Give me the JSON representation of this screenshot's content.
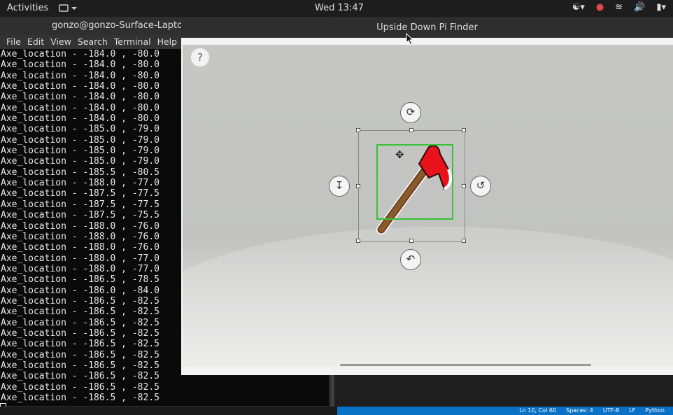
{
  "topbar": {
    "activities": "Activities",
    "clock": "Wed 13:47",
    "tray_icons": [
      "accessibility-icon",
      "record-icon",
      "wifi-icon",
      "volume-icon",
      "battery-icon",
      "power-menu-icon"
    ]
  },
  "terminal": {
    "title": "gonzo@gonzo-Surface-Laptop-",
    "menu": [
      "File",
      "Edit",
      "View",
      "Search",
      "Terminal",
      "Help"
    ],
    "lines": [
      "Axe_location - -184.0 , -80.0",
      "Axe_location - -184.0 , -80.0",
      "Axe_location - -184.0 , -80.0",
      "Axe_location - -184.0 , -80.0",
      "Axe_location - -184.0 , -80.0",
      "Axe_location - -184.0 , -80.0",
      "Axe_location - -184.0 , -80.0",
      "Axe_location - -185.0 , -79.0",
      "Axe_location - -185.0 , -79.0",
      "Axe_location - -185.0 , -79.0",
      "Axe_location - -185.0 , -79.0",
      "Axe_location - -185.5 , -80.5",
      "Axe_location - -188.0 , -77.0",
      "Axe_location - -187.5 , -77.5",
      "Axe_location - -187.5 , -77.5",
      "Axe_location - -187.5 , -75.5",
      "Axe_location - -188.0 , -76.0",
      "Axe_location - -188.0 , -76.0",
      "Axe_location - -188.0 , -76.0",
      "Axe_location - -188.0 , -77.0",
      "Axe_location - -188.0 , -77.0",
      "Axe_location - -186.5 , -78.5",
      "Axe_location - -186.0 , -84.0",
      "Axe_location - -186.5 , -82.5",
      "Axe_location - -186.5 , -82.5",
      "Axe_location - -186.5 , -82.5",
      "Axe_location - -186.5 , -82.5",
      "Axe_location - -186.5 , -82.5",
      "Axe_location - -186.5 , -82.5",
      "Axe_location - -186.5 , -82.5",
      "Axe_location - -186.5 , -82.5",
      "Axe_location - -186.5 , -82.5",
      "Axe_location - -186.5 , -82.5"
    ]
  },
  "pi_window": {
    "title": "Upside Down Pi Finder",
    "help": "?"
  },
  "statusbar": [
    "Ln 10, Col 60",
    "Spaces: 4",
    "UTF-8",
    "LF",
    "Python"
  ],
  "colors": {
    "axe_head": "#e8121b",
    "axe_handle": "#8b5a2b",
    "hitbox": "#36c236",
    "statusbar": "#0a72c6"
  }
}
